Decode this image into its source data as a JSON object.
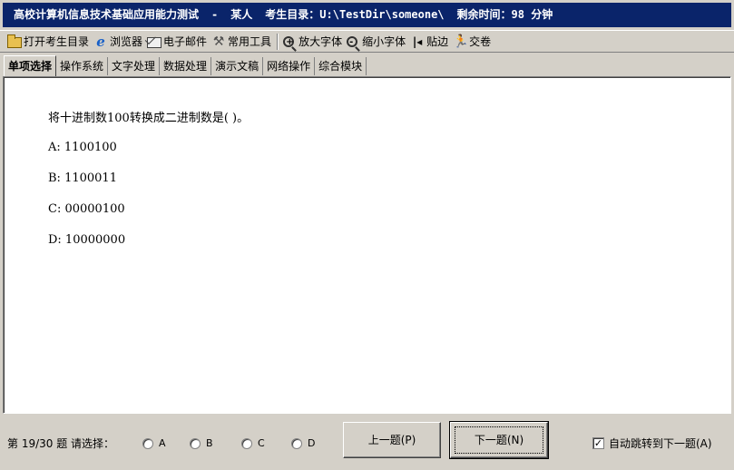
{
  "title": {
    "exam_name": "高校计算机信息技术基础应用能力测试",
    "separator": "-",
    "examinee": "某人",
    "dir_label": "考生目录：U:\\TestDir\\someone\\",
    "time_label": "剩余时间：98 分钟"
  },
  "toolbar": {
    "open_dir": "打开考生目录",
    "browser": "浏览器",
    "email": "电子邮件",
    "tools": "常用工具",
    "zoom_in": "放大字体",
    "zoom_out": "缩小字体",
    "dock": "贴边",
    "submit": "交卷"
  },
  "tabs": [
    "单项选择",
    "操作系统",
    "文字处理",
    "数据处理",
    "演示文稿",
    "网络操作",
    "综合模块"
  ],
  "active_tab": 0,
  "question": {
    "text": "将十进制数100转换成二进制数是(  )。",
    "options": [
      "A: 1100100",
      "B: 1100011",
      "C: 00000100",
      "D: 10000000"
    ]
  },
  "footer": {
    "progress": "第 19/30 题 请选择：",
    "choices": [
      "A",
      "B",
      "C",
      "D"
    ],
    "prev_button": "上一题(P)",
    "next_button": "下一题(N)",
    "auto_next_label": "自动跳转到下一题(A)",
    "auto_next_checked": true
  }
}
